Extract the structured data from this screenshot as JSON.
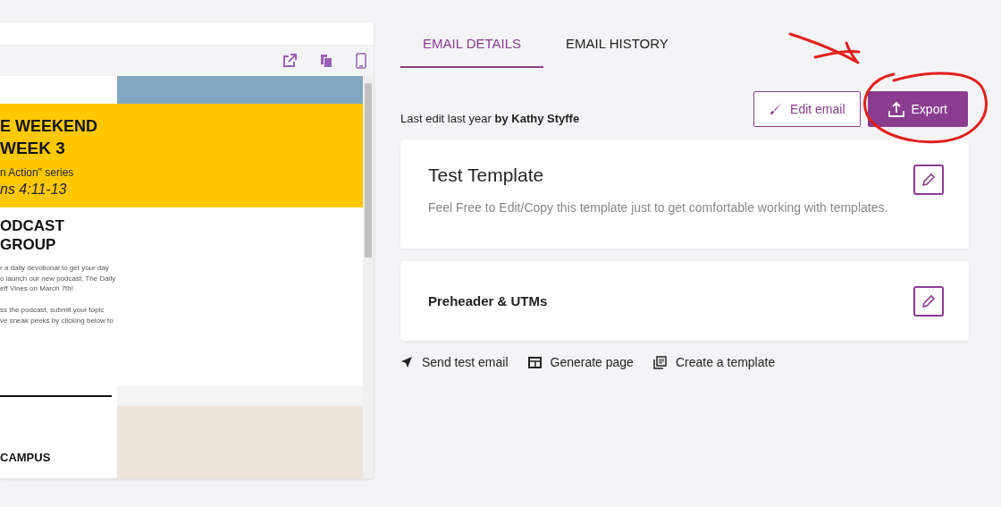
{
  "preview": {
    "email": {
      "banner_title": "E WEEKEND",
      "banner_week": "WEEK 3",
      "banner_series": "n Action\" series",
      "banner_verse": "ns 4:11-13",
      "section_title_lines": [
        "ODCAST",
        "GROUP"
      ],
      "paragraphs": [
        [
          "r a daily devotional to get your day",
          "o launch our new podcast, The Daily",
          "eff Vines on March 7th!"
        ],
        [
          "ss the podcast, submit your topic",
          "ve sneak peeks by clicking below to"
        ]
      ],
      "campus_title": "CAMPUS"
    }
  },
  "tabs": [
    {
      "label": "EMAIL DETAILS",
      "selected": true
    },
    {
      "label": "EMAIL HISTORY",
      "selected": false
    }
  ],
  "last_edit": "Last edit last year **by Kathy Styffe**",
  "buttons": [
    {
      "kind": "outline",
      "label": "Edit email"
    },
    {
      "kind": "primary",
      "label": "Export"
    }
  ],
  "cards": [
    {
      "title": "Test Template",
      "description": "Feel Free to Edit/Copy this template just to get comfortable working with templates.",
      "kind": "large"
    },
    {
      "title": "Preheader & UTMs",
      "kind": "small"
    }
  ],
  "actions": [
    {
      "kind": "send",
      "label": "Send test email"
    },
    {
      "kind": "page",
      "label": "Generate page"
    },
    {
      "kind": "template",
      "label": "Create a template"
    }
  ]
}
